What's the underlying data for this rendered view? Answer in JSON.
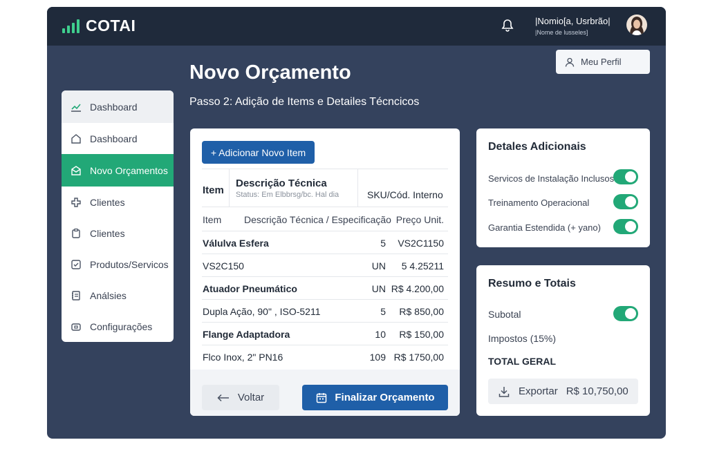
{
  "app": {
    "brand": "COTAI"
  },
  "header": {
    "user_name": "|Nomio[a, Usrbrão|",
    "user_role": "|Nome de lusseles]",
    "profile_button": "Meu Perfil"
  },
  "page": {
    "title": "Novo Orçamento",
    "subtitle": "Passo 2: Adição de Items e Detailes Técncicos"
  },
  "sidebar": {
    "items": [
      {
        "label": "Dashboard",
        "icon": "chart-line-icon",
        "state": "hover"
      },
      {
        "label": "Dashboard",
        "icon": "home-icon"
      },
      {
        "label": "Novo Orçamentos",
        "icon": "envelope-icon",
        "state": "active"
      },
      {
        "label": "Clientes",
        "icon": "puzzle-icon"
      },
      {
        "label": "Clientes",
        "icon": "clipboard-icon"
      },
      {
        "label": "Produtos/Servicos",
        "icon": "checkbox-icon"
      },
      {
        "label": "Análsies",
        "icon": "notebook-icon"
      },
      {
        "label": "Configurações",
        "icon": "settings-icon"
      }
    ]
  },
  "items": {
    "add_button": "+ Adicionar Novo Item",
    "header_main": {
      "item": "Item",
      "description": "Descrição Técnica",
      "status": "Status: Em Elbbrsg/bc. Hal dia",
      "sku": "SKU/Cód. Interno"
    },
    "header_sub": {
      "item": "Item",
      "description": "Descrição Técnica / Especificação",
      "price": "Preço Unit."
    },
    "rows": [
      {
        "name": "Válulva Esfera",
        "qty": "5",
        "price": "VS2C1150",
        "bold": true
      },
      {
        "name": "VS2C150",
        "qty": "UN",
        "price": "5 4.25211",
        "bold": false
      },
      {
        "name": "Atuador Pneumático",
        "qty": "UN",
        "price": "R$ 4.200,00",
        "bold": true
      },
      {
        "name": "Dupla Ação, 90\" , ISO-5211",
        "qty": "5",
        "price": "R$ 850,00",
        "bold": false
      },
      {
        "name": "Flange Adaptadora",
        "qty": "10",
        "price": "R$ 150,00",
        "bold": true
      },
      {
        "name": "Flco Inox, 2\" PN16",
        "qty": "109",
        "price": "R$ 1750,00",
        "bold": false
      }
    ],
    "back_button": "Voltar",
    "finish_button": "Finalizar Orçamento"
  },
  "details": {
    "title": "Detales Adicionais",
    "options": [
      {
        "label": "Servicos de Instalação Inclusos",
        "enabled": true
      },
      {
        "label": "Treinamento Operacional",
        "enabled": true
      },
      {
        "label": "Garantia Estendida (+ yano)",
        "enabled": true
      }
    ]
  },
  "summary": {
    "title": "Resumo e Totais",
    "subtotal_label": "Subotal",
    "subtotal_enabled": true,
    "taxes_label": "Impostos (15%)",
    "total_label": "TOTAL GERAL",
    "export_label": "Exportar",
    "total_value": "R$ 10,750,00"
  },
  "colors": {
    "frame": "#34425d",
    "topbar": "#1f2a3b",
    "accent_green": "#22a877",
    "primary_blue": "#1f5fa8"
  }
}
